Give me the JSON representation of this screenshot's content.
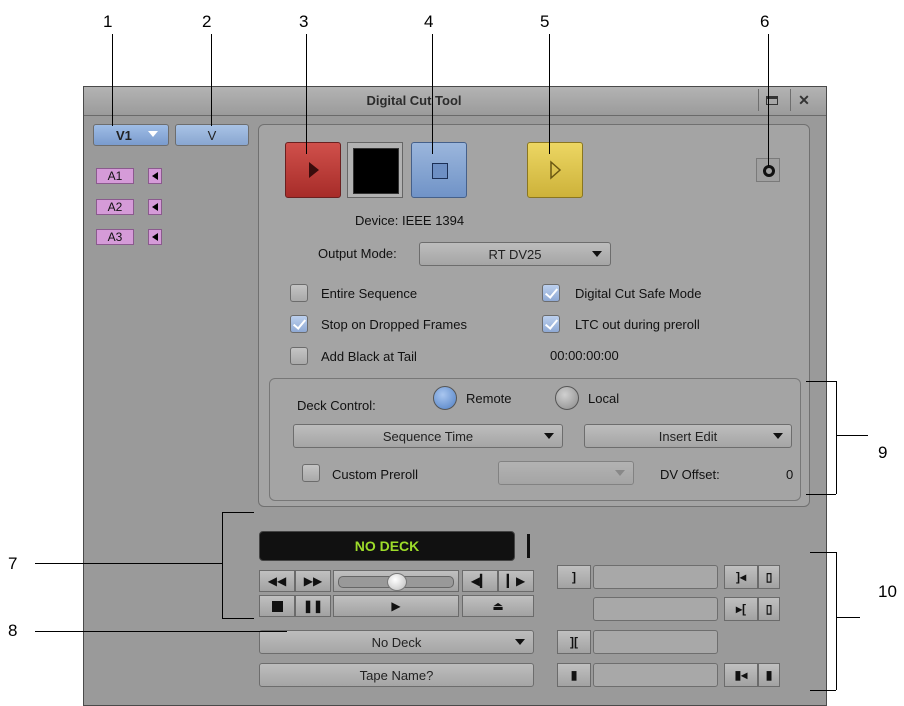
{
  "callouts": [
    "1",
    "2",
    "3",
    "4",
    "5",
    "6",
    "7",
    "8",
    "9",
    "10"
  ],
  "window": {
    "title": "Digital Cut Tool"
  },
  "tracks": {
    "video_selector": "V1",
    "video_track": "V",
    "audio": [
      "A1",
      "A2",
      "A3"
    ]
  },
  "output": {
    "device_text": "Device: IEEE 1394",
    "output_mode_label": "Output Mode:",
    "output_mode_value": "RT DV25"
  },
  "options": {
    "entire_sequence": {
      "label": "Entire Sequence",
      "checked": false
    },
    "stop_on_dropped": {
      "label": "Stop on Dropped Frames",
      "checked": true
    },
    "add_black": {
      "label": "Add Black at Tail",
      "checked": false
    },
    "safe_mode": {
      "label": "Digital Cut Safe Mode",
      "checked": true
    },
    "ltc_out": {
      "label": "LTC out during preroll",
      "checked": true
    },
    "timecode": "00:00:00:00"
  },
  "deck": {
    "label": "Deck Control:",
    "remote": "Remote",
    "local": "Local",
    "time_mode": "Sequence Time",
    "edit_mode": "Insert Edit",
    "custom_preroll": "Custom Preroll",
    "preroll_value": "",
    "dv_offset_label": "DV Offset:",
    "dv_offset_value": "0"
  },
  "transport": {
    "status": "NO DECK",
    "deck_select": "No Deck",
    "tape_name": "Tape Name?"
  },
  "colors": {
    "record": "#c23a36",
    "play_preview": "#e0c84a",
    "status_text": "#9ddc2a",
    "stop_btn": "#86a6d2"
  }
}
